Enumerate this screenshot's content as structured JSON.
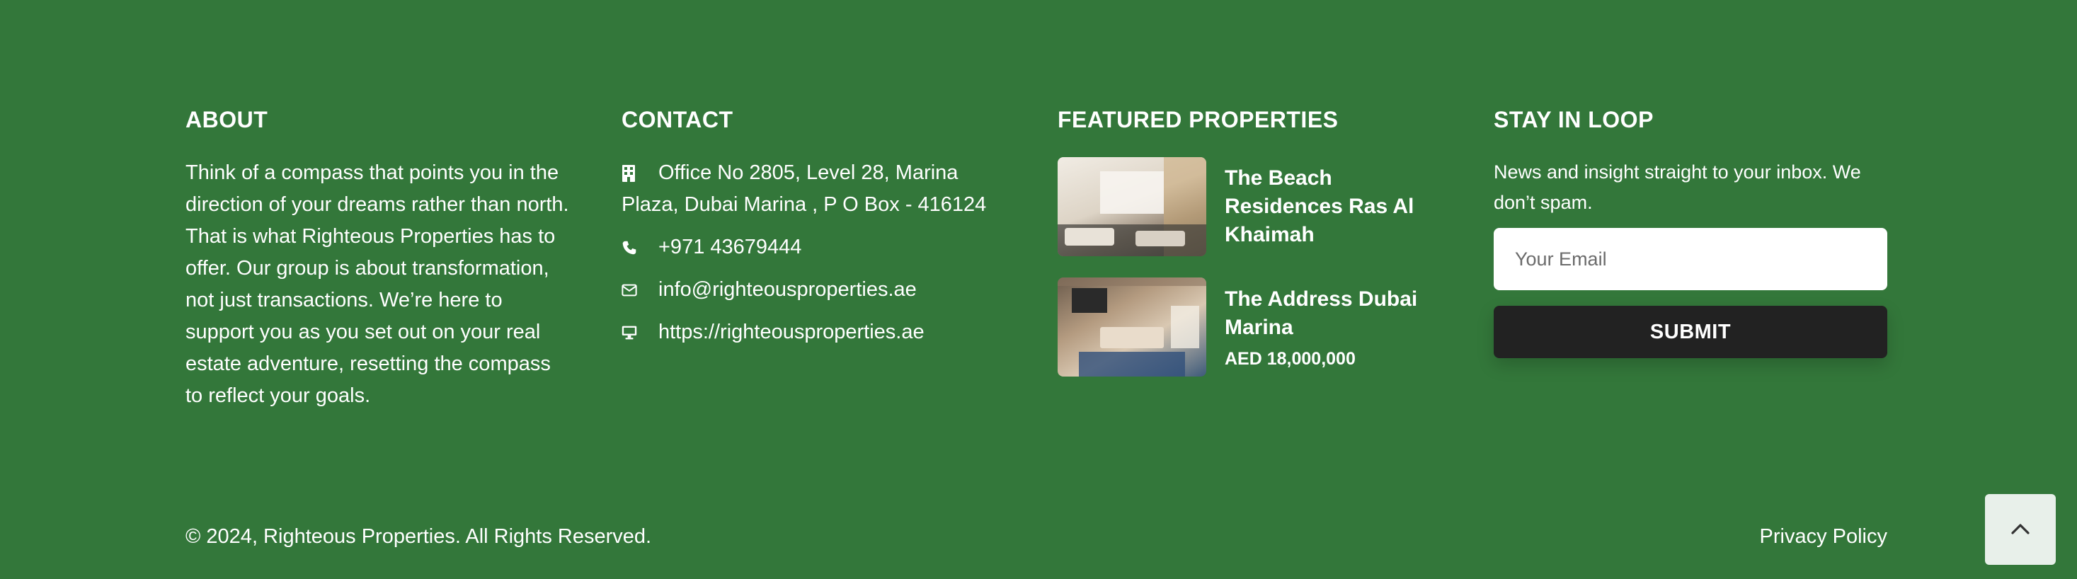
{
  "about": {
    "title": "ABOUT",
    "text": "Think of a compass that points you in the direction of your dreams rather than north. That is what Righteous Properties has to offer. Our group is about transformation, not just transactions. We’re here to support you as you set out on your real estate adventure, resetting the compass to reflect your goals."
  },
  "contact": {
    "title": "CONTACT",
    "address": "Office No 2805, Level 28, Marina Plaza, Dubai Marina , P O Box - 416124",
    "phone": "+971 43679444",
    "email": "info@righteousproperties.ae",
    "website": "https://righteousproperties.ae",
    "icons": [
      "building-icon",
      "phone-icon",
      "envelope-icon",
      "desktop-icon"
    ]
  },
  "featured": {
    "title": "FEATURED PROPERTIES",
    "items": [
      {
        "name": "The Beach Residences Ras Al Khaimah",
        "price": ""
      },
      {
        "name": "The Address Dubai Marina",
        "price": "AED 18,000,000"
      }
    ]
  },
  "loop": {
    "title": "STAY IN LOOP",
    "text": "News and insight straight to your inbox. We don’t spam.",
    "email_placeholder": "Your Email",
    "email_value": "",
    "submit_label": "SUBMIT"
  },
  "bottom": {
    "copyright": "© 2024, Righteous Properties. All Rights Reserved.",
    "privacy_label": "Privacy Policy",
    "scroll_top_icon": "chevron-up-icon"
  },
  "colors": {
    "footer_bg": "#33773a",
    "button_dark": "#222222",
    "scroll_top_bg": "#e8f0ea"
  }
}
